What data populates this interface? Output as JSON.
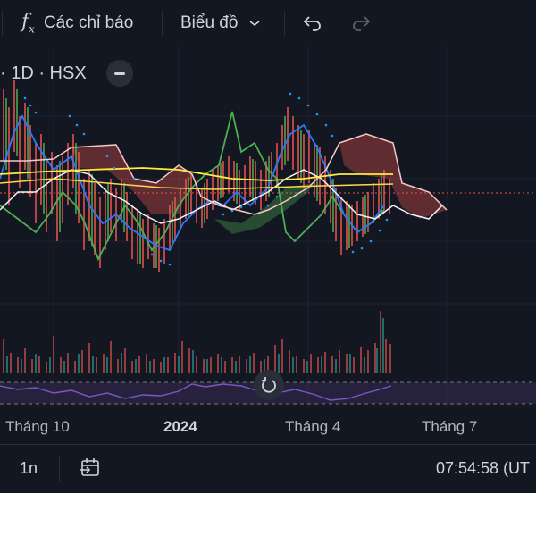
{
  "toolbar": {
    "indicators_label": "Các chỉ báo",
    "chart_type_label": "Biểu đồ"
  },
  "legend": {
    "symbol_interval": "· 1D · HSX"
  },
  "time_axis": {
    "labels": [
      "Tháng 10",
      "2024",
      "Tháng 4",
      "Tháng 7"
    ]
  },
  "bottom": {
    "range_label": "1n",
    "clock": "07:54:58 (UT"
  },
  "colors": {
    "background": "#131722",
    "red": "#ef5350",
    "green": "#4caf50",
    "blue": "#2962ff",
    "cyan_dots": "#2196f3",
    "yellow": "#ffeb3b",
    "pink_line": "#f7c8c8",
    "rsi_purple": "#7e57c2"
  }
}
